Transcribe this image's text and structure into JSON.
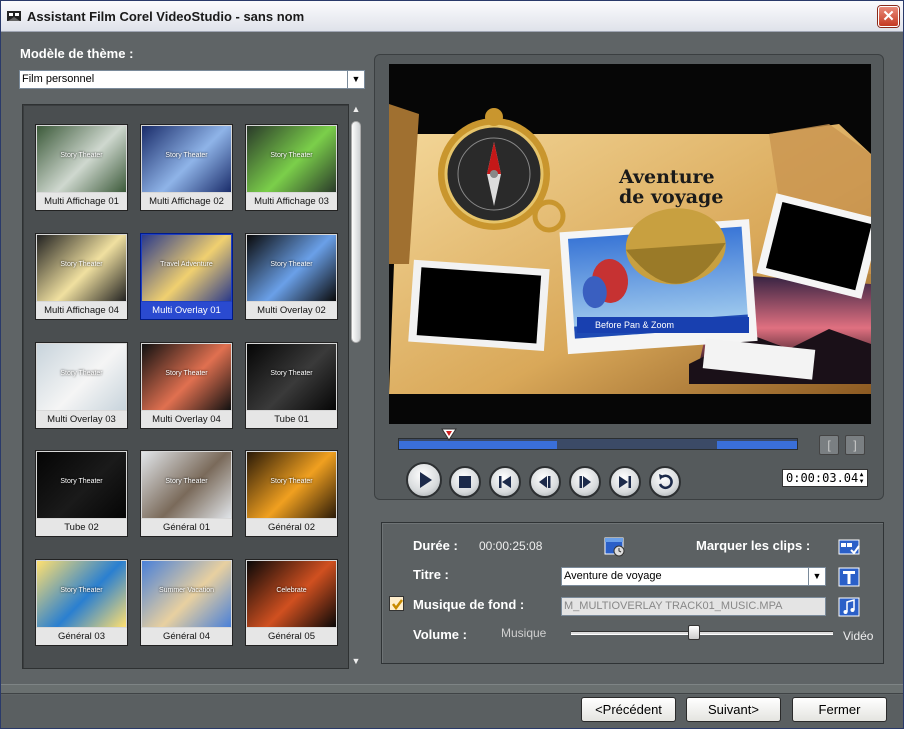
{
  "window": {
    "title": "Assistant Film Corel VideoStudio - sans nom",
    "close_glyph": "✕"
  },
  "theme": {
    "label": "Modèle de thème :",
    "selected": "Film personnel",
    "templates": [
      {
        "label": "Multi Affichage 01",
        "overlay": "Story Theater"
      },
      {
        "label": "Multi Affichage 02",
        "overlay": "Story Theater"
      },
      {
        "label": "Multi Affichage 03",
        "overlay": "Story Theater"
      },
      {
        "label": "Multi Affichage 04",
        "overlay": "Story Theater"
      },
      {
        "label": "Multi Overlay 01",
        "overlay": "Travel Adventure",
        "selected": true
      },
      {
        "label": "Multi Overlay 02",
        "overlay": "Story Theater"
      },
      {
        "label": "Multi Overlay 03",
        "overlay": "Story Theater"
      },
      {
        "label": "Multi Overlay 04",
        "overlay": "Story Theater"
      },
      {
        "label": "Tube 01",
        "overlay": "Story Theater"
      },
      {
        "label": "Tube 02",
        "overlay": "Story Theater"
      },
      {
        "label": "Général 01",
        "overlay": "Story Theater"
      },
      {
        "label": "Général 02",
        "overlay": "Story Theater"
      },
      {
        "label": "Général 03",
        "overlay": "Story Theater"
      },
      {
        "label": "Général 04",
        "overlay": "Summer Vacation"
      },
      {
        "label": "Général 05",
        "overlay": "Celebrate"
      }
    ]
  },
  "preview": {
    "title_line1": "Aventure",
    "title_line2": "de voyage",
    "caption": "Before Pan & Zoom",
    "timecode": "0:00:03.04",
    "mark_in": "[",
    "mark_out": "]"
  },
  "properties": {
    "duration_label": "Durée :",
    "duration_value": "00:00:25:08",
    "mark_clips_label": "Marquer les clips :",
    "title_label": "Titre :",
    "title_value": "Aventure  de voyage",
    "music_label": "Musique de fond :",
    "music_checked": true,
    "music_value": "M_MULTIOVERLAY TRACK01_MUSIC.MPA",
    "volume_label": "Volume :",
    "volume_left": "Musique",
    "volume_right": "Vidéo",
    "volume_level": 0.47
  },
  "footer": {
    "prev": "<Précédent",
    "next": "Suivant>",
    "close": "Fermer"
  },
  "colors": {
    "accent": "#2a4ad0",
    "timeline": "#3a6fd8",
    "frame": "#5f6466"
  }
}
